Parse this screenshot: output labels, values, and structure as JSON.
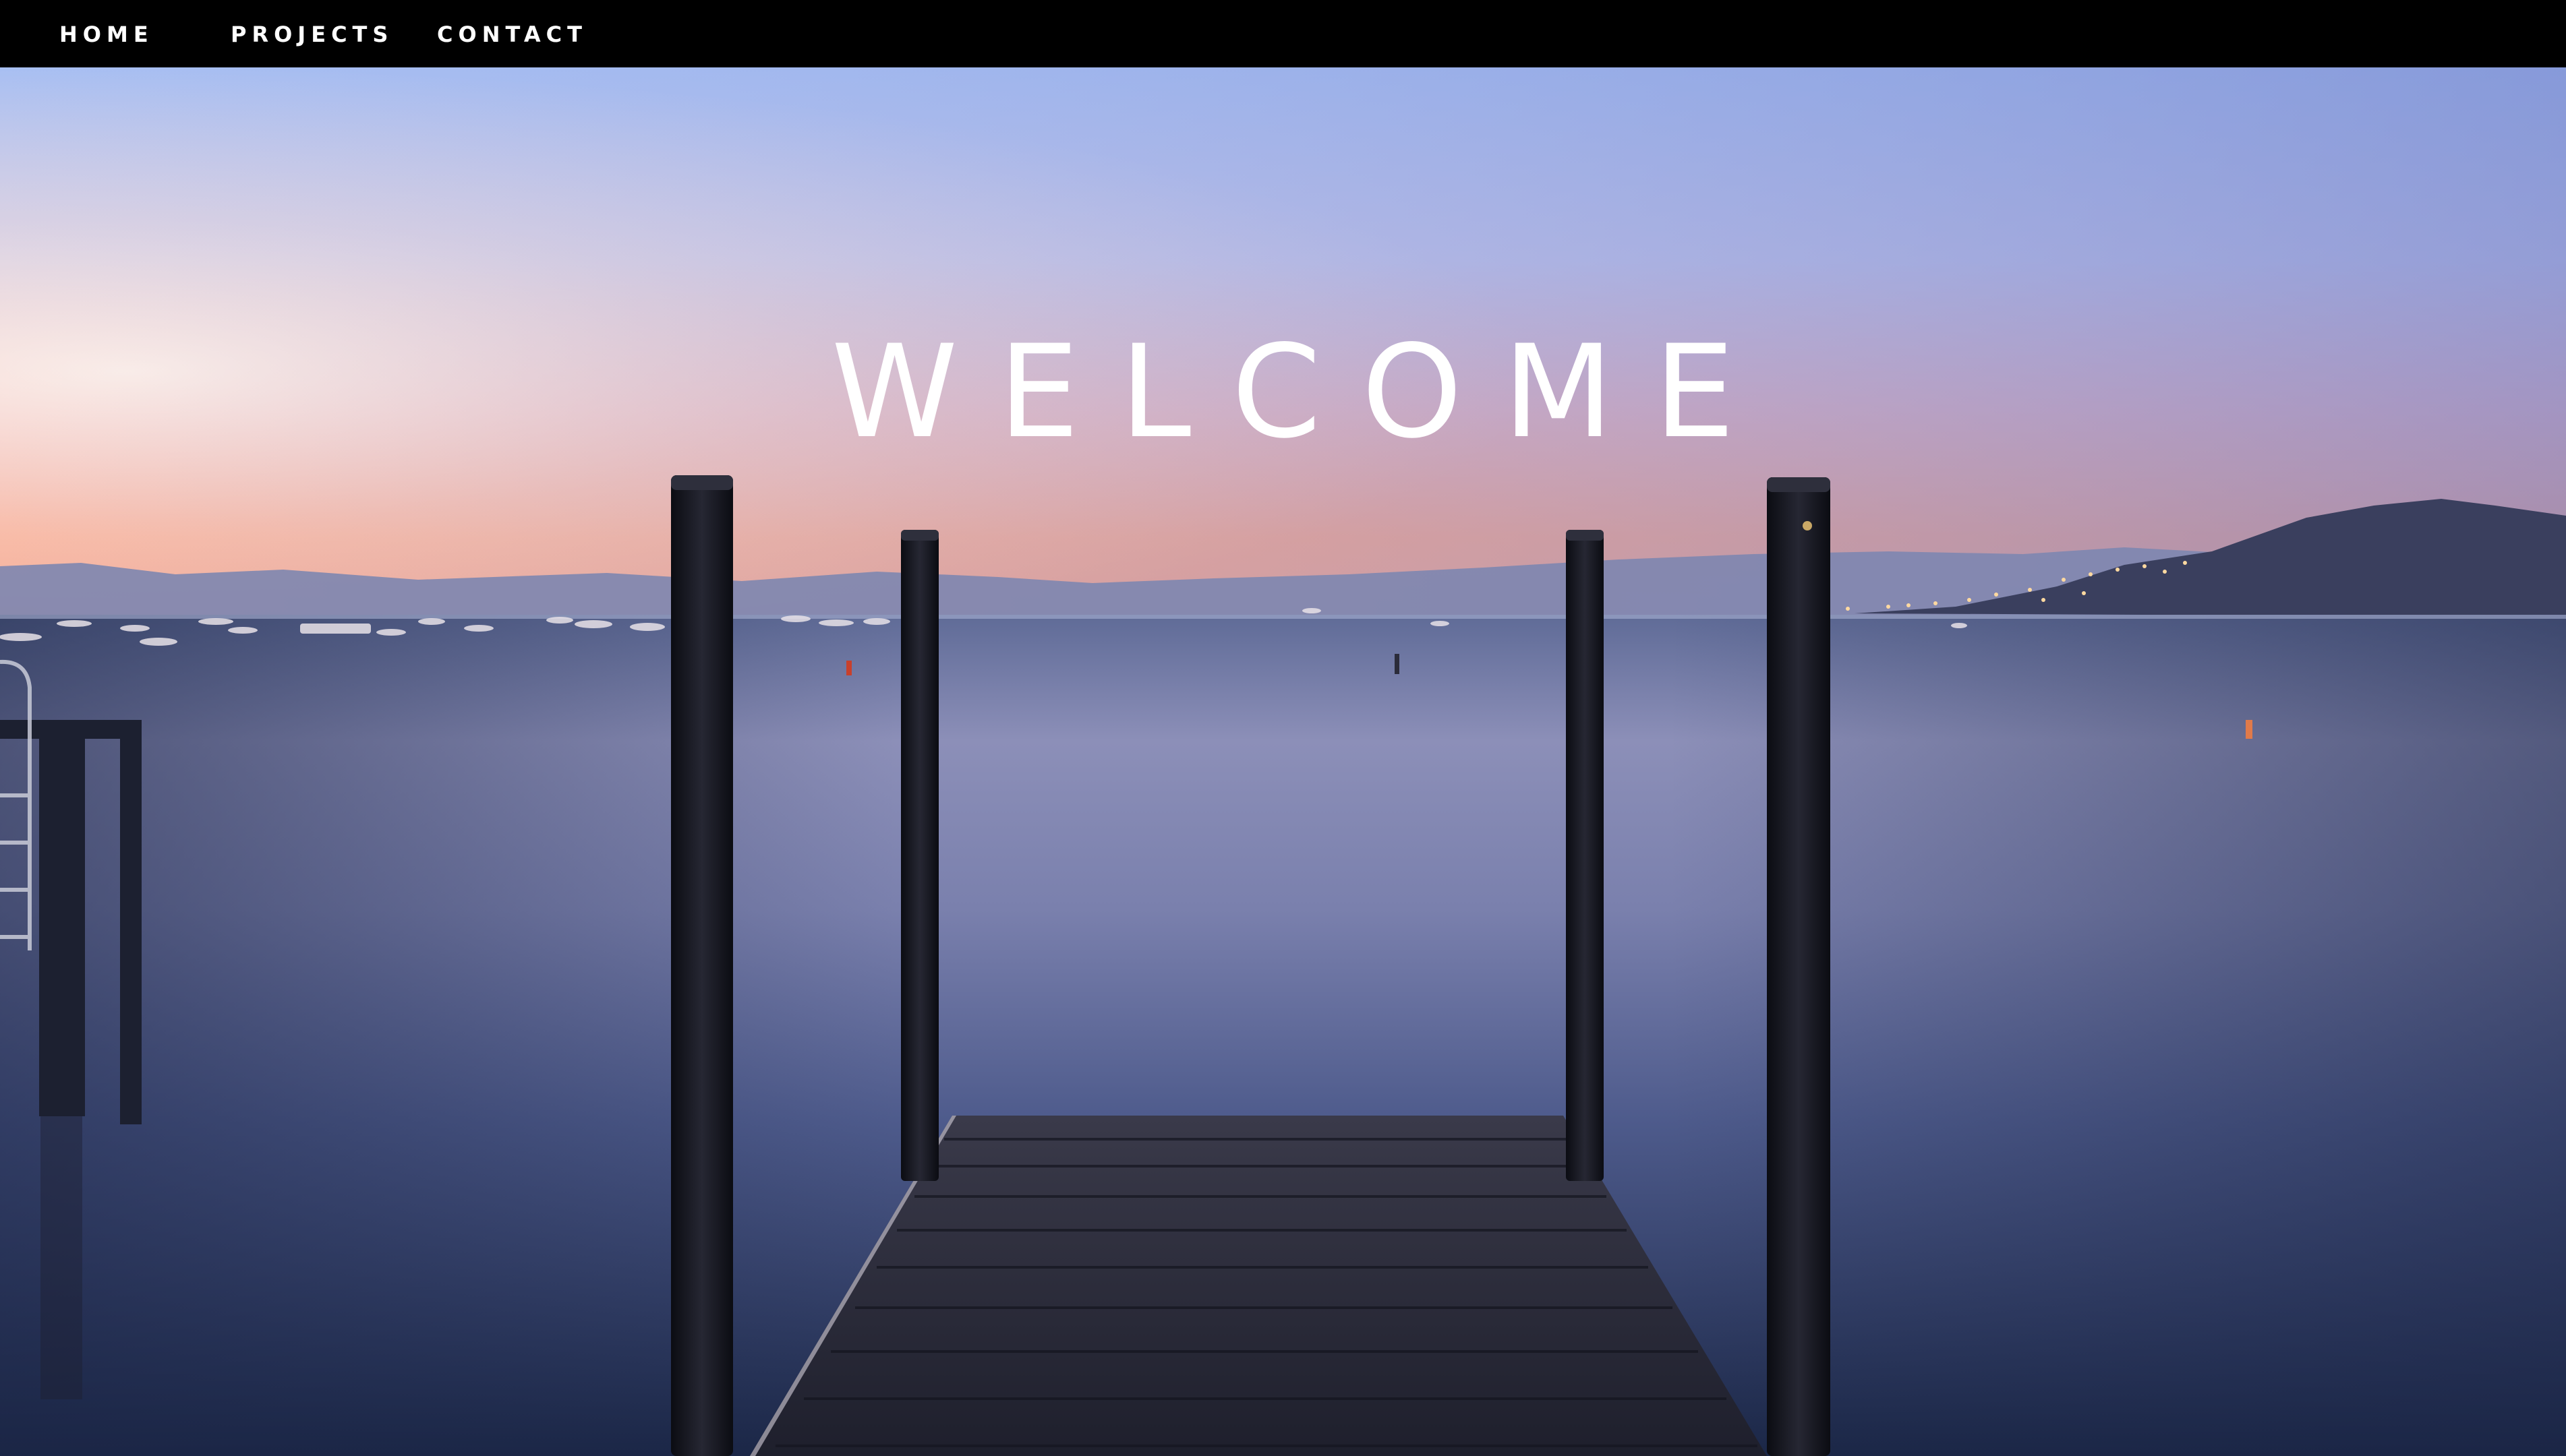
{
  "nav": {
    "items": [
      {
        "label": "HOME"
      },
      {
        "label": "PROJECTS"
      },
      {
        "label": "CONTACT"
      }
    ]
  },
  "hero": {
    "heading": "WELCOME",
    "image": "lake-dock-at-dusk"
  },
  "colors": {
    "navbar": "#000000",
    "text": "#ffffff",
    "sky_top": "#a9c0f2",
    "sky_horizon": "#f3a890",
    "water": "#5b6895"
  }
}
